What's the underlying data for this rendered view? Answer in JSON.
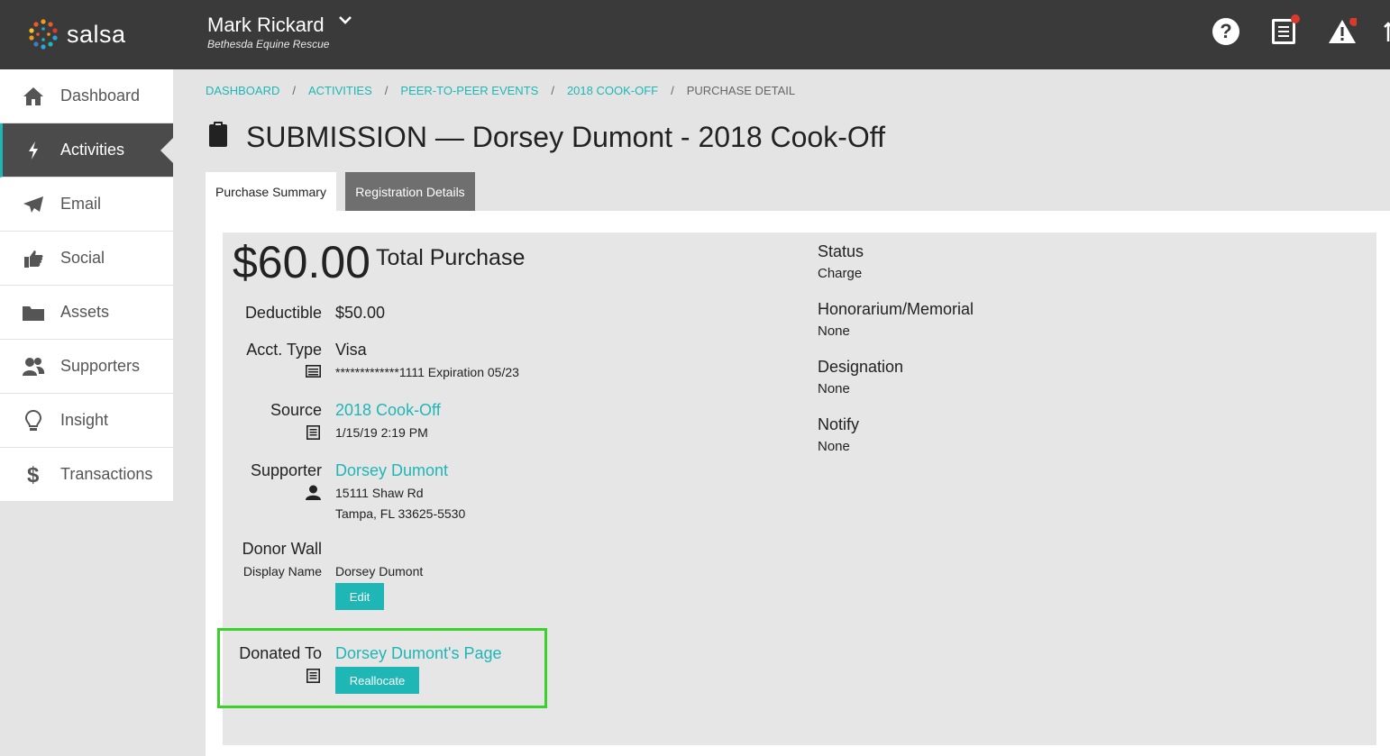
{
  "header": {
    "logo_text": "salsa",
    "account_name": "Mark Rickard",
    "account_org": "Bethesda Equine Rescue",
    "help_glyph": "?"
  },
  "sidebar": {
    "items": [
      {
        "label": "Dashboard",
        "icon": "home-icon"
      },
      {
        "label": "Activities",
        "icon": "lightning-icon",
        "active": true
      },
      {
        "label": "Email",
        "icon": "paper-plane-icon"
      },
      {
        "label": "Social",
        "icon": "thumbs-up-icon"
      },
      {
        "label": "Assets",
        "icon": "folder-icon"
      },
      {
        "label": "Supporters",
        "icon": "users-icon"
      },
      {
        "label": "Insight",
        "icon": "lightbulb-icon"
      },
      {
        "label": "Transactions",
        "icon": "dollar-icon"
      }
    ]
  },
  "breadcrumb": {
    "items": [
      "DASHBOARD",
      "ACTIVITIES",
      "PEER-TO-PEER EVENTS",
      "2018 COOK-OFF"
    ],
    "current": "PURCHASE DETAIL",
    "separator": "/"
  },
  "page": {
    "title": "SUBMISSION — Dorsey Dumont - 2018 Cook-Off"
  },
  "tabs": {
    "purchase_summary": "Purchase Summary",
    "registration_details": "Registration Details"
  },
  "summary": {
    "amount": "$60.00",
    "amount_label": "Total Purchase",
    "deductible_label": "Deductible",
    "deductible_value": "$50.00",
    "acct_type_label": "Acct. Type",
    "acct_type_value": "Visa",
    "card_detail": "*************1111 Expiration 05/23",
    "source_label": "Source",
    "source_link": "2018 Cook-Off",
    "source_date": "1/15/19 2:19 PM",
    "supporter_label": "Supporter",
    "supporter_link": "Dorsey Dumont",
    "supporter_address1": "15111 Shaw Rd",
    "supporter_address2": "Tampa, FL 33625-5530",
    "donor_wall_label": "Donor Wall",
    "display_name_label": "Display Name",
    "display_name_value": "Dorsey Dumont",
    "edit_button": "Edit",
    "donated_to_label": "Donated To",
    "donated_to_link": "Dorsey Dumont's Page",
    "reallocate_button": "Reallocate"
  },
  "details": {
    "status_label": "Status",
    "status_value": "Charge",
    "honorarium_label": "Honorarium/Memorial",
    "honorarium_value": "None",
    "designation_label": "Designation",
    "designation_value": "None",
    "notify_label": "Notify",
    "notify_value": "None"
  },
  "colors": {
    "accent": "#1fb6b6",
    "topbar": "#3a3a3a",
    "highlight": "#39d12a",
    "badge": "#d93a2b"
  }
}
